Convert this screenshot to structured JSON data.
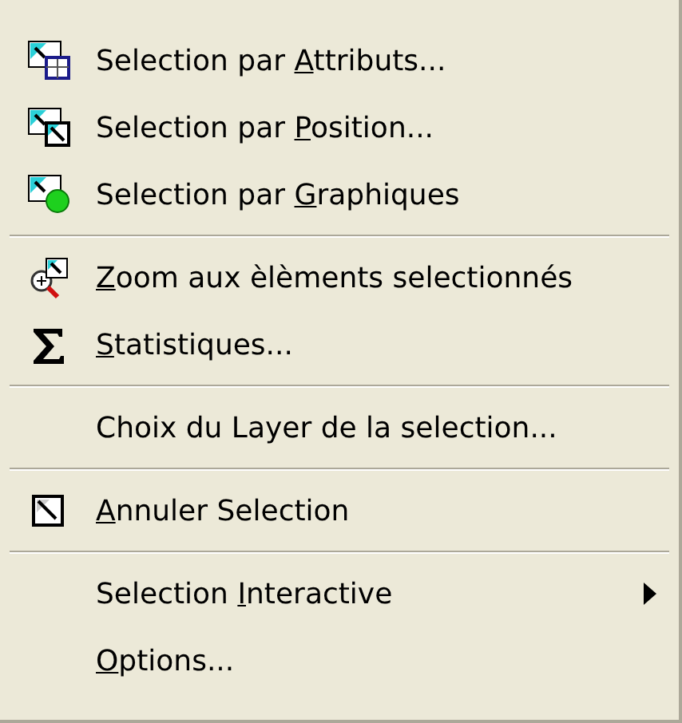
{
  "menu": {
    "items": [
      {
        "kind": "item",
        "text_before": "Selection par ",
        "access_key": "A",
        "text_after": "ttributs...",
        "submenu": false
      },
      {
        "kind": "item",
        "text_before": "Selection par ",
        "access_key": "P",
        "text_after": "osition...",
        "submenu": false
      },
      {
        "kind": "item",
        "text_before": "Selection par ",
        "access_key": "G",
        "text_after": "raphiques",
        "submenu": false
      },
      {
        "kind": "separator"
      },
      {
        "kind": "item",
        "access_key": "Z",
        "text_after": "oom aux èlèments selectionnés",
        "submenu": false
      },
      {
        "kind": "item",
        "access_key": "S",
        "text_after": "tatistiques...",
        "submenu": false
      },
      {
        "kind": "separator"
      },
      {
        "kind": "item",
        "text_after": "Choix du Layer de la selection...",
        "submenu": false
      },
      {
        "kind": "separator"
      },
      {
        "kind": "item",
        "access_key": "A",
        "text_after": "nnuler Selection",
        "submenu": false
      },
      {
        "kind": "separator"
      },
      {
        "kind": "item",
        "text_before": "Selection ",
        "access_key": "I",
        "text_after": "nteractive",
        "submenu": true
      },
      {
        "kind": "item",
        "access_key": "O",
        "text_after": "ptions...",
        "submenu": false
      }
    ]
  }
}
